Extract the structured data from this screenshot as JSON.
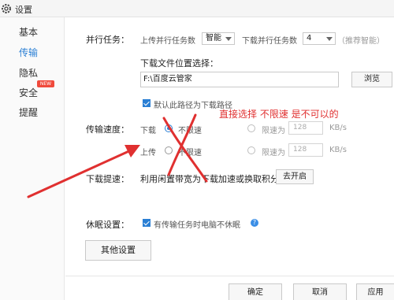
{
  "window": {
    "title": "设置"
  },
  "sidebar": {
    "items": [
      {
        "label": "基本"
      },
      {
        "label": "传输"
      },
      {
        "label": "隐私"
      },
      {
        "label": "安全"
      },
      {
        "label": "提醒"
      }
    ],
    "new_badge": "NEW"
  },
  "parallel": {
    "label": "并行任务：",
    "upload_label": "上传并行任务数",
    "upload_value": "智能",
    "download_label": "下载并行任务数",
    "download_value": "4",
    "recommend": "（推荐智能）"
  },
  "download_location": {
    "label": "下载文件位置选择：",
    "path": "F:\\百度云管家",
    "browse": "浏览",
    "default_checkbox": "默认此路径为下载路径"
  },
  "speed": {
    "label": "传输速度：",
    "download_label": "下载",
    "download_unlimited": "不限速",
    "download_limit_label": "限速为",
    "download_limit_value": "128",
    "upload_label": "上传",
    "upload_unlimited": "不限速",
    "upload_limit_label": "限速为",
    "upload_limit_value": "128",
    "unit": "KB/s"
  },
  "annotation": "直接选择 不限速 是不可以的",
  "accelerate": {
    "label": "下载提速：",
    "text": "利用闲置带宽为下载加速或换取积分",
    "button": "去开启"
  },
  "sleep": {
    "label": "休眠设置：",
    "checkbox": "有传输任务时电脑不休眠",
    "help": "?"
  },
  "other_settings": "其他设置",
  "footer": {
    "confirm": "确定",
    "cancel": "取消",
    "apply": "应用"
  },
  "colors": {
    "accent": "#2a7fd4",
    "annotation_red": "#e03030"
  }
}
